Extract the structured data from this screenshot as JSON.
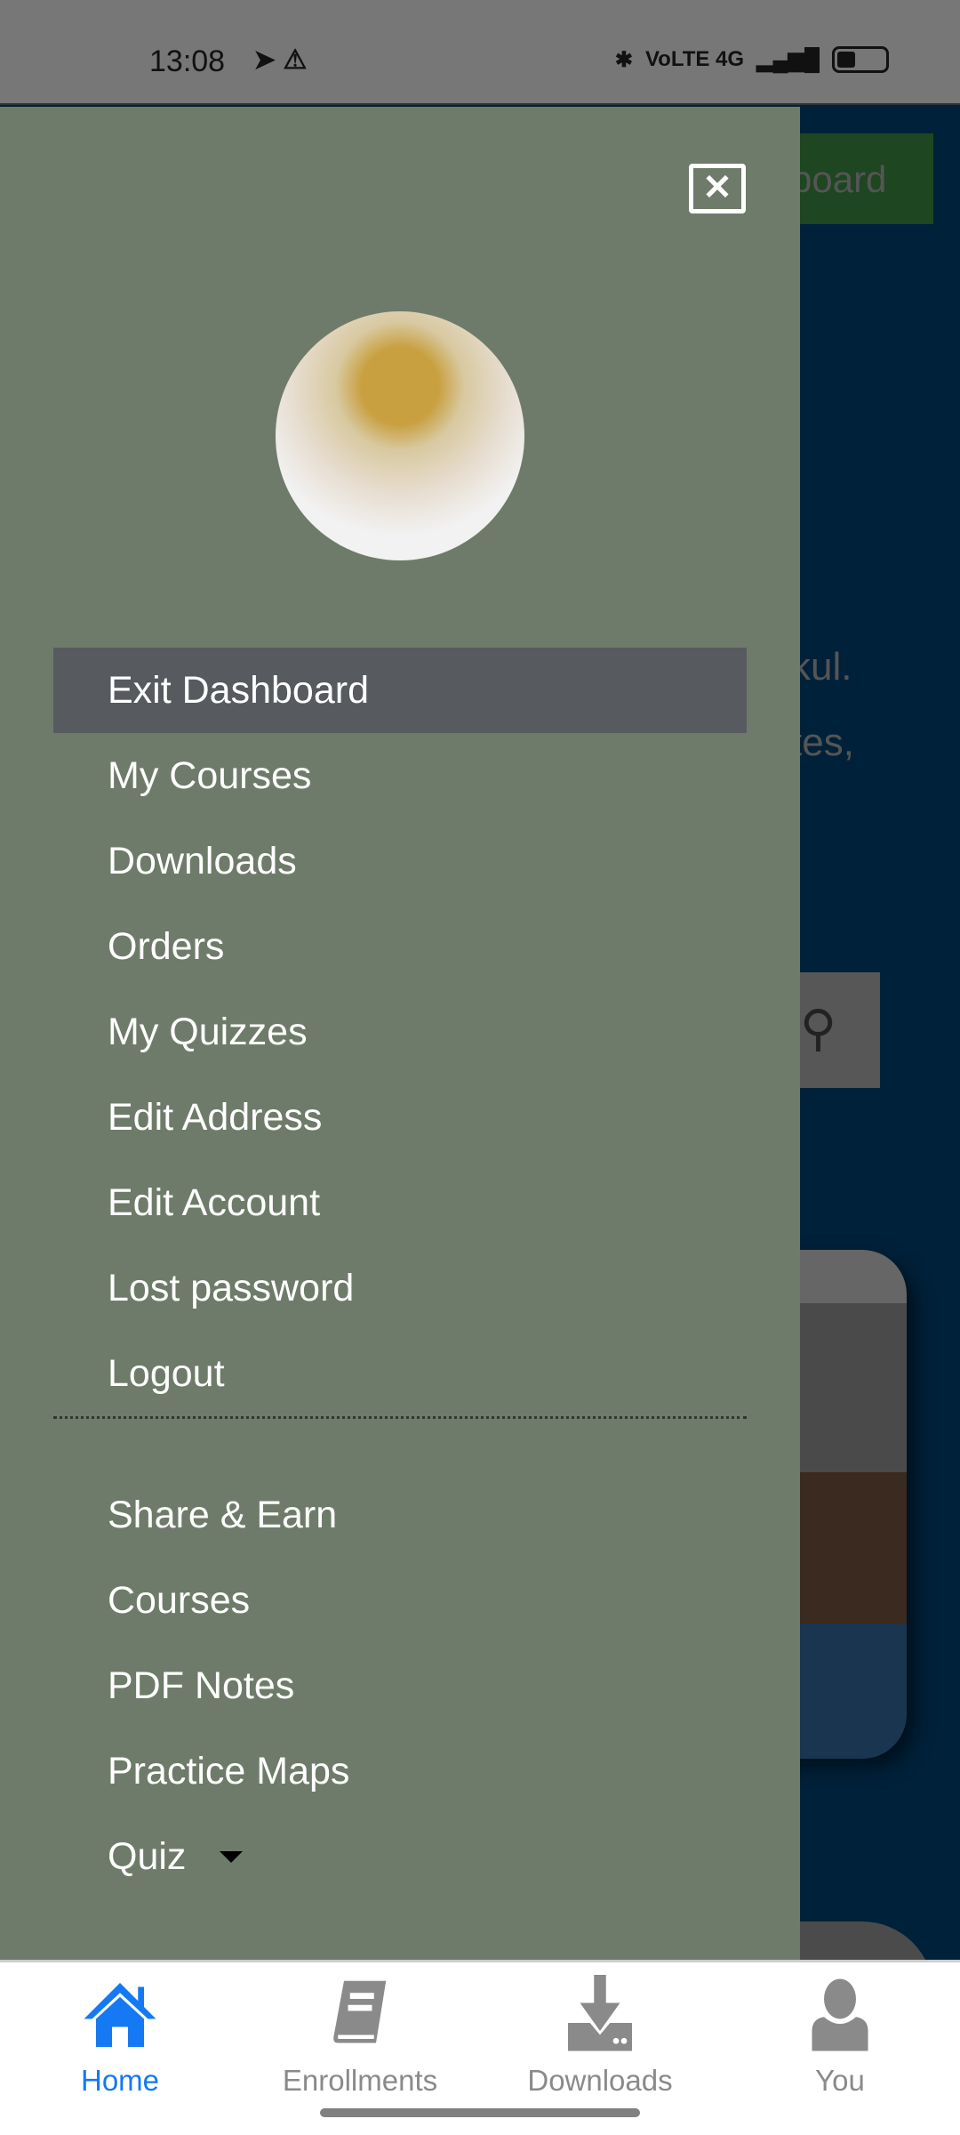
{
  "status_bar": {
    "time": "13:08",
    "right_indicators": "VoLTE 4G"
  },
  "background": {
    "button_partial": "board",
    "text_line1": "kul.",
    "text_line2": "tes,"
  },
  "drawer": {
    "menu": [
      {
        "label": "Exit Dashboard",
        "active": true
      },
      {
        "label": "My Courses"
      },
      {
        "label": "Downloads"
      },
      {
        "label": "Orders"
      },
      {
        "label": "My Quizzes"
      },
      {
        "label": "Edit Address"
      },
      {
        "label": "Edit Account"
      },
      {
        "label": "Lost password"
      },
      {
        "label": "Logout"
      }
    ],
    "menu2": [
      {
        "label": "Share & Earn"
      },
      {
        "label": "Courses"
      },
      {
        "label": "PDF Notes"
      },
      {
        "label": "Practice Maps"
      },
      {
        "label": "Quiz"
      }
    ]
  },
  "bottom_nav": {
    "tabs": [
      {
        "label": "Home",
        "icon": "home-icon",
        "active": true
      },
      {
        "label": "Enrollments",
        "icon": "book-icon"
      },
      {
        "label": "Downloads",
        "icon": "download-icon"
      },
      {
        "label": "You",
        "icon": "user-icon"
      }
    ]
  },
  "colors": {
    "drawer": "#6f7b6a",
    "active_item": "#575a5f",
    "accent": "#1479f2",
    "page_bg": "#00213a"
  }
}
